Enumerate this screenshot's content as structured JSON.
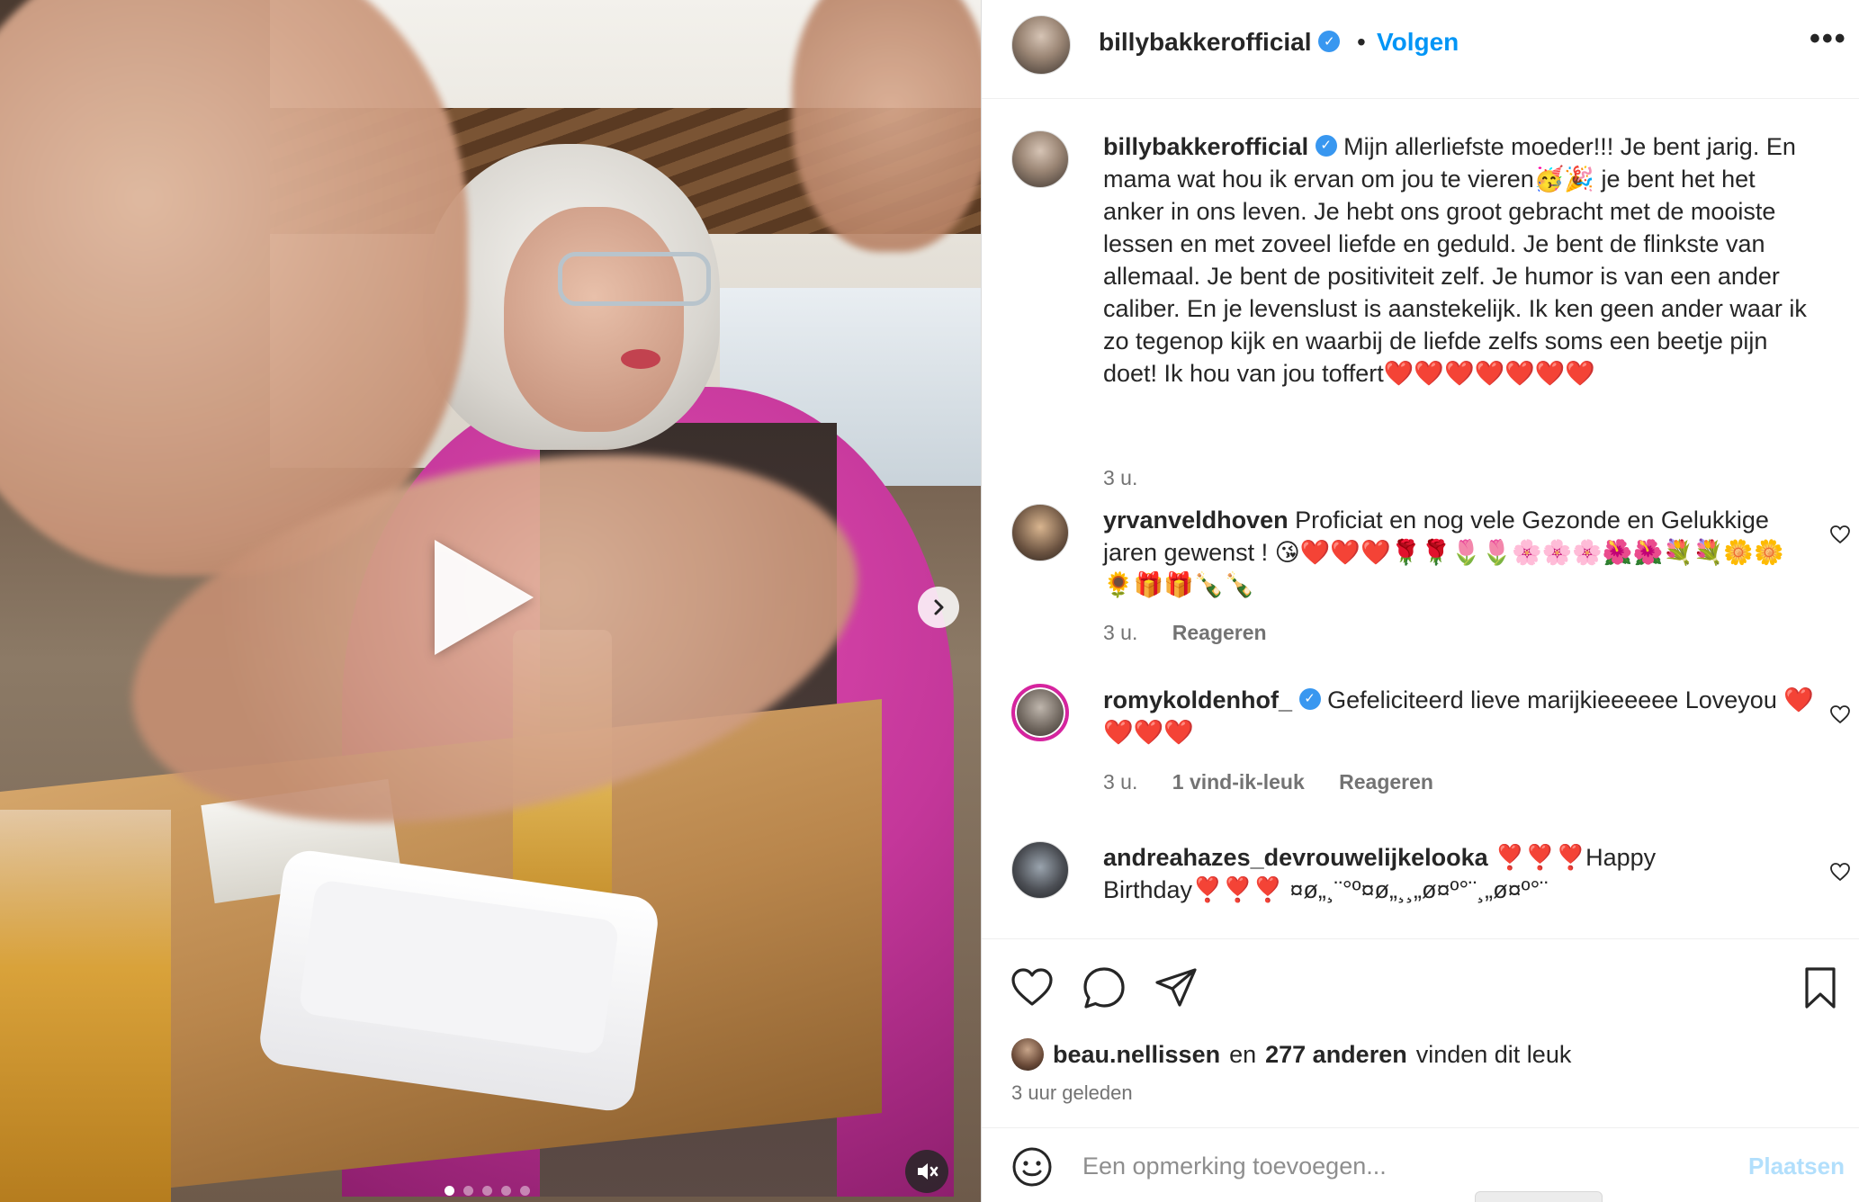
{
  "post": {
    "author": "billybakkerofficial",
    "separator": "•",
    "follow_label": "Volgen",
    "more_label": "•••",
    "caption": "Mijn allerliefste moeder!!! Je bent jarig. En mama wat hou ik ervan om jou te vieren🥳🎉 je bent het het anker in ons leven. Je hebt ons groot gebracht met de mooiste lessen en met zoveel liefde en geduld. Je bent de flinkste van allemaal. Je bent de positiviteit zelf. Je humor is van een ander caliber. En je levenslust is aanstekelijk. Ik ken geen ander waar ik zo tegenop kijk en waarbij de liefde zelfs soms een beetje pijn doet! Ik hou van jou toffert❤️❤️❤️❤️❤️❤️❤️",
    "caption_time": "3 u."
  },
  "media": {
    "slide_count": 5,
    "active_slide": 1,
    "play_icon": "play-icon",
    "next_icon": "chevron-right-icon",
    "mute_icon": "muted-speaker-icon"
  },
  "comments": [
    {
      "user": "yrvanveldhoven",
      "text": "Proficiat en nog vele Gezonde en Gelukkige jaren gewenst ! 😘❤️❤️❤️🌹🌹🌷🌷🌸🌸🌸🌺🌺💐💐🌼🌼🌻🎁🎁🍾🍾",
      "time": "3 u.",
      "likes": "",
      "reply": "Reageren"
    },
    {
      "user": "romykoldenhof_",
      "text": "Gefeliciteerd lieve marijkieeeeee Loveyou ❤️❤️❤️❤️",
      "time": "3 u.",
      "likes": "1 vind-ik-leuk",
      "reply": "Reageren"
    },
    {
      "user": "andreahazes_devrouwelijkelooka",
      "text": "❣️❣️❣️Happy Birthday❣️❣️❣️ ¤ø„¸¨°º¤ø„¸¸„ø¤º°¨¸„ø¤º°¨",
      "time": "",
      "likes": "",
      "reply": ""
    }
  ],
  "likes_bar": {
    "liker": "beau.nellissen",
    "connector": "en",
    "others": "277 anderen",
    "suffix": "vinden dit leuk",
    "posted": "3 uur geleden"
  },
  "composer": {
    "placeholder": "Een opmerking toevoegen...",
    "post_label": "Plaatsen"
  },
  "colors": {
    "accent": "#0095f6",
    "verified": "#3897f0",
    "post_disabled": "#b2dffc",
    "muted_text": "#737373"
  }
}
